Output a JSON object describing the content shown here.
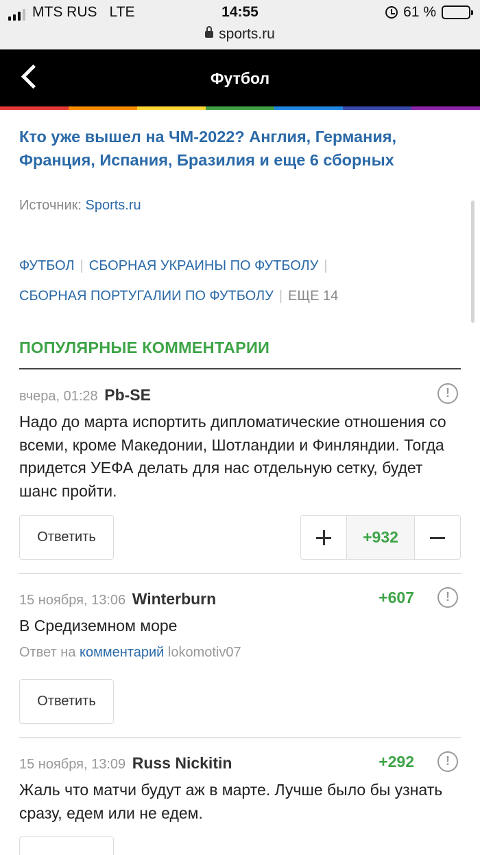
{
  "status_bar": {
    "carrier": "MTS RUS",
    "network": "LTE",
    "time": "14:55",
    "battery": "61 %",
    "battery_level": 0.61,
    "url": "sports.ru"
  },
  "header": {
    "title": "Футбол",
    "back_icon": "chevron-left-icon"
  },
  "accent_colors": [
    "#e53935",
    "#fb8c00",
    "#fdd835",
    "#43a047",
    "#1e88e5",
    "#3949ab",
    "#8e24aa"
  ],
  "article": {
    "title": "Кто уже вышел на ЧМ-2022? Англия, Германия, Франция, Испания, Бразилия и еще 6 сборных",
    "source_label": "Источник:",
    "source_link": "Sports.ru"
  },
  "tags": {
    "items": [
      "ФУТБОЛ",
      "СБОРНАЯ УКРАИНЫ ПО ФУТБОЛУ",
      "СБОРНАЯ ПОРТУГАЛИИ ПО ФУТБОЛУ"
    ],
    "more": "ЕЩЕ 14"
  },
  "comments_section": {
    "title": "ПОПУЛЯРНЫЕ КОММЕНТАРИИ",
    "report_glyph": "!",
    "reply_label": "Ответить",
    "comments": [
      {
        "time": "вчера, 01:28",
        "author": "Pb-SE",
        "text": "Надо до марта испортить дипломатические отношения со всеми, кроме Македонии, Шотландии и Финляндии. Тогда придется УЕФА делать для нас отдельную сетку, будет шанс пройти.",
        "score": "+932"
      },
      {
        "time": "15 ноября, 13:06",
        "author": "Winterburn",
        "score": "+607",
        "text": "В Средиземном море",
        "reply_to_prefix": "Ответ на",
        "reply_to_link": "комментарий",
        "reply_to_user": "lokomotiv07"
      },
      {
        "time": "15 ноября, 13:09",
        "author": "Russ Nickitin",
        "score": "+292",
        "text": "Жаль что матчи будут аж в марте. Лучше было бы узнать сразу, едем или не едем."
      }
    ]
  }
}
